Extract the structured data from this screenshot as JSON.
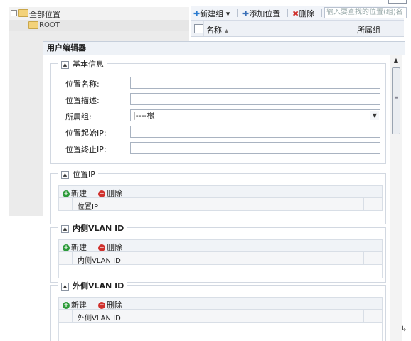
{
  "tree": {
    "root_label": "全部位置",
    "child_label": "ROOT"
  },
  "toolbar": {
    "new_group": "新建组",
    "add_location": "添加位置",
    "delete": "删除",
    "search_placeholder": "输入要查找的位置(组)名"
  },
  "grid": {
    "col_name": "名称",
    "col_group": "所属组"
  },
  "dialog": {
    "title": "用户编辑器",
    "basic_info": {
      "legend": "基本信息",
      "fields": [
        {
          "label": "位置名称:",
          "value": ""
        },
        {
          "label": "位置描述:",
          "value": ""
        },
        {
          "label": "所属组:",
          "value": "|----根"
        },
        {
          "label": "位置起始IP:",
          "value": ""
        },
        {
          "label": "位置终止IP:",
          "value": ""
        }
      ]
    },
    "location_ip": {
      "legend": "位置IP",
      "new_label": "新建",
      "delete_label": "删除",
      "column": "位置IP"
    },
    "inner_vlan": {
      "legend": "内侧VLAN ID",
      "new_label": "新建",
      "delete_label": "删除",
      "column": "内侧VLAN ID"
    },
    "outer_vlan": {
      "legend": "外侧VLAN ID",
      "new_label": "新建",
      "delete_label": "删除",
      "column": "外侧VLAN ID"
    }
  },
  "colors": {
    "accent_green": "#2d9b3b",
    "accent_red": "#d0312d",
    "panel_bg": "#eef2f7"
  }
}
